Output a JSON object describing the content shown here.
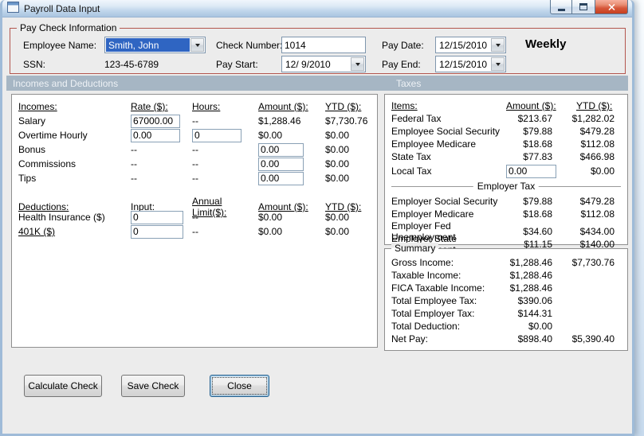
{
  "window": {
    "title": "Payroll Data Input"
  },
  "paycheck": {
    "legend": "Pay Check Information",
    "employee_name": {
      "label": "Employee Name:",
      "value": "Smith, John"
    },
    "ssn": {
      "label": "SSN:",
      "value": "123-45-6789"
    },
    "check_number": {
      "label": "Check Number:",
      "value": "1014"
    },
    "pay_start": {
      "label": "Pay Start:",
      "value": "12/ 9/2010"
    },
    "pay_date": {
      "label": "Pay Date:",
      "value": "12/15/2010"
    },
    "pay_end": {
      "label": "Pay End:",
      "value": "12/15/2010"
    },
    "frequency": "Weekly"
  },
  "section_headers": {
    "incomes": "Incomes and Deductions",
    "taxes": "Taxes"
  },
  "incomes": {
    "headers": {
      "name": "Incomes:",
      "rate": "Rate ($):",
      "hours": "Hours:",
      "amount": "Amount ($):",
      "ytd": "YTD ($):"
    },
    "salary": {
      "label": "Salary",
      "rate": "67000.00",
      "hours": "--",
      "amount": "$1,288.46",
      "ytd": "$7,730.76"
    },
    "overtime": {
      "label": "Overtime Hourly",
      "rate": "0.00",
      "hours": "0",
      "amount": "$0.00",
      "ytd": "$0.00"
    },
    "bonus": {
      "label": "Bonus",
      "rate": "--",
      "hours": "--",
      "amount": "0.00",
      "ytd": "$0.00"
    },
    "commissions": {
      "label": "Commissions",
      "rate": "--",
      "hours": "--",
      "amount": "0.00",
      "ytd": "$0.00"
    },
    "tips": {
      "label": "Tips",
      "rate": "--",
      "hours": "--",
      "amount": "0.00",
      "ytd": "$0.00"
    }
  },
  "deductions": {
    "headers": {
      "name": "Deductions:",
      "input": "Input:",
      "limit": "Annual Limit($):",
      "amount": "Amount ($):",
      "ytd": "YTD ($):"
    },
    "health_insurance": {
      "label": "Health Insurance ($)",
      "input": "0",
      "limit": "--",
      "amount": "$0.00",
      "ytd": "$0.00"
    },
    "k401": {
      "label": "401K ($)",
      "input": "0",
      "limit": "--",
      "amount": "$0.00",
      "ytd": "$0.00"
    }
  },
  "taxes": {
    "headers": {
      "items": "Items:",
      "amount": "Amount ($):",
      "ytd": "YTD ($):"
    },
    "employee_rows": [
      {
        "label": "Federal Tax",
        "amount": "$213.67",
        "ytd": "$1,282.02"
      },
      {
        "label": "Employee Social Security",
        "amount": "$79.88",
        "ytd": "$479.28"
      },
      {
        "label": "Employee Medicare",
        "amount": "$18.68",
        "ytd": "$112.08"
      },
      {
        "label": "State Tax",
        "amount": "$77.83",
        "ytd": "$466.98"
      }
    ],
    "local_tax": {
      "label": "Local Tax",
      "input": "0.00",
      "ytd": "$0.00"
    },
    "employer_group_label": "Employer Tax",
    "employer_rows": [
      {
        "label": "Employer Social Security",
        "amount": "$79.88",
        "ytd": "$479.28"
      },
      {
        "label": "Employer Medicare",
        "amount": "$18.68",
        "ytd": "$112.08"
      },
      {
        "label": "Employer Fed Unemployment",
        "amount": "$34.60",
        "ytd": "$434.00"
      },
      {
        "label": "Employer State Unemployment",
        "amount": "$11.15",
        "ytd": "$140.00"
      }
    ]
  },
  "summary": {
    "legend": "Summary",
    "rows": [
      {
        "label": "Gross Income:",
        "amount": "$1,288.46",
        "ytd": "$7,730.76"
      },
      {
        "label": "Taxable Income:",
        "amount": "$1,288.46",
        "ytd": ""
      },
      {
        "label": "FICA Taxable Income:",
        "amount": "$1,288.46",
        "ytd": ""
      },
      {
        "label": "Total Employee Tax:",
        "amount": "$390.06",
        "ytd": ""
      },
      {
        "label": "Total Employer Tax:",
        "amount": "$144.31",
        "ytd": ""
      },
      {
        "label": "Total Deduction:",
        "amount": "$0.00",
        "ytd": ""
      },
      {
        "label": "Net Pay:",
        "amount": "$898.40",
        "ytd": "$5,390.40"
      }
    ]
  },
  "buttons": {
    "calculate": "Calculate Check",
    "save": "Save Check",
    "close": "Close"
  }
}
